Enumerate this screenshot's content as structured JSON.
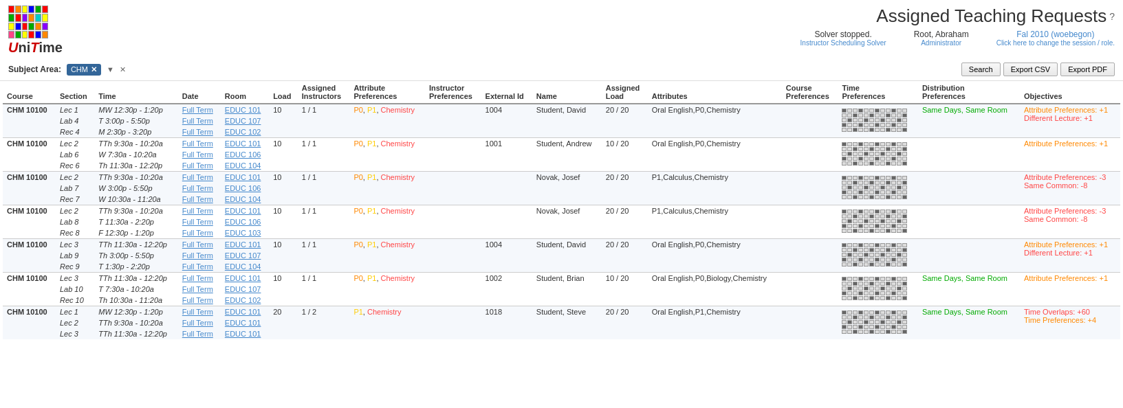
{
  "header": {
    "title": "Assigned Teaching Requests",
    "help_icon": "?",
    "solver_status": "Solver stopped.",
    "solver_label": "Instructor Scheduling Solver",
    "user_name": "Root, Abraham",
    "user_role": "Administrator",
    "session": "Fal 2010 (woebegon)",
    "session_sub": "Click here to change the session / role."
  },
  "toolbar": {
    "subject_area_label": "Subject Area:",
    "subject_tag": "CHM",
    "filter_down": "▼",
    "filter_clear": "✕",
    "search_label": "Search",
    "export_csv_label": "Export CSV",
    "export_pdf_label": "Export PDF"
  },
  "table": {
    "columns": [
      "Course",
      "Section",
      "Time",
      "Date",
      "Room",
      "Load",
      "Assigned Instructors",
      "Attribute Preferences",
      "Instructor Preferences",
      "External Id",
      "Name",
      "Assigned Load",
      "Attributes",
      "Course Preferences",
      "Time Preferences",
      "Distribution Preferences",
      "Objectives"
    ],
    "rows": [
      {
        "course": "CHM 10100",
        "section": "Lec 1",
        "time": "MW 12:30p - 1:20p",
        "date": "Full Term",
        "room": "EDUC 101",
        "load": "10",
        "assigned_load": "1 / 1",
        "attr_pref": "P0, P1, Chemistry",
        "instructor_pref": "",
        "external_id": "1004",
        "name": "Student, David",
        "assigned": "20 / 20",
        "attributes": "Oral English,P0,Chemistry",
        "course_pref": "",
        "dist_pref": "Same Days, Same Room",
        "objectives": "Attribute Preferences: +1\nDifferent Lecture: +1",
        "sub_rows": [
          {
            "section": "Lab 4",
            "time": "T 3:00p - 5:50p",
            "date": "Full Term",
            "room": "EDUC 107"
          },
          {
            "section": "Rec 4",
            "time": "M 2:30p - 3:20p",
            "date": "Full Term",
            "room": "EDUC 102"
          }
        ]
      },
      {
        "course": "CHM 10100",
        "section": "Lec 2",
        "time": "TTh 9:30a - 10:20a",
        "date": "Full Term",
        "room": "EDUC 101",
        "load": "10",
        "assigned_load": "1 / 1",
        "attr_pref": "P0, P1, Chemistry",
        "instructor_pref": "",
        "external_id": "1001",
        "name": "Student, Andrew",
        "assigned": "10 / 20",
        "attributes": "Oral English,P0,Chemistry",
        "course_pref": "",
        "dist_pref": "",
        "objectives": "Attribute Preferences: +1",
        "sub_rows": [
          {
            "section": "Lab 6",
            "time": "W 7:30a - 10:20a",
            "date": "Full Term",
            "room": "EDUC 106"
          },
          {
            "section": "Rec 6",
            "time": "Th 11:30a - 12:20p",
            "date": "Full Term",
            "room": "EDUC 104"
          }
        ]
      },
      {
        "course": "CHM 10100",
        "section": "Lec 2",
        "time": "TTh 9:30a - 10:20a",
        "date": "Full Term",
        "room": "EDUC 101",
        "load": "10",
        "assigned_load": "1 / 1",
        "attr_pref": "P0, P1, Chemistry",
        "instructor_pref": "",
        "external_id": "",
        "name": "Novak, Josef",
        "assigned": "20 / 20",
        "attributes": "P1,Calculus,Chemistry",
        "course_pref": "",
        "dist_pref": "",
        "objectives": "Attribute Preferences: -3\nSame Common: -8",
        "sub_rows": [
          {
            "section": "Lab 7",
            "time": "W 3:00p - 5:50p",
            "date": "Full Term",
            "room": "EDUC 106"
          },
          {
            "section": "Rec 7",
            "time": "W 10:30a - 11:20a",
            "date": "Full Term",
            "room": "EDUC 104"
          }
        ]
      },
      {
        "course": "CHM 10100",
        "section": "Lec 2",
        "time": "TTh 9:30a - 10:20a",
        "date": "Full Term",
        "room": "EDUC 101",
        "load": "10",
        "assigned_load": "1 / 1",
        "attr_pref": "P0, P1, Chemistry",
        "instructor_pref": "",
        "external_id": "",
        "name": "Novak, Josef",
        "assigned": "20 / 20",
        "attributes": "P1,Calculus,Chemistry",
        "course_pref": "",
        "dist_pref": "",
        "objectives": "Attribute Preferences: -3\nSame Common: -8",
        "sub_rows": [
          {
            "section": "Lab 8",
            "time": "T 11:30a - 2:20p",
            "date": "Full Term",
            "room": "EDUC 106"
          },
          {
            "section": "Rec 8",
            "time": "F 12:30p - 1:20p",
            "date": "Full Term",
            "room": "EDUC 103"
          }
        ]
      },
      {
        "course": "CHM 10100",
        "section": "Lec 3",
        "time": "TTh 11:30a - 12:20p",
        "date": "Full Term",
        "room": "EDUC 101",
        "load": "10",
        "assigned_load": "1 / 1",
        "attr_pref": "P0, P1, Chemistry",
        "instructor_pref": "",
        "external_id": "1004",
        "name": "Student, David",
        "assigned": "20 / 20",
        "attributes": "Oral English,P0,Chemistry",
        "course_pref": "",
        "dist_pref": "",
        "objectives": "Attribute Preferences: +1\nDifferent Lecture: +1",
        "sub_rows": [
          {
            "section": "Lab 9",
            "time": "Th 3:00p - 5:50p",
            "date": "Full Term",
            "room": "EDUC 107"
          },
          {
            "section": "Rec 9",
            "time": "T 1:30p - 2:20p",
            "date": "Full Term",
            "room": "EDUC 104"
          }
        ]
      },
      {
        "course": "CHM 10100",
        "section": "Lec 3",
        "time": "TTh 11:30a - 12:20p",
        "date": "Full Term",
        "room": "EDUC 101",
        "load": "10",
        "assigned_load": "1 / 1",
        "attr_pref": "P0, P1, Chemistry",
        "instructor_pref": "",
        "external_id": "1002",
        "name": "Student, Brian",
        "assigned": "10 / 20",
        "attributes": "Oral English,P0,Biology,Chemistry",
        "course_pref": "",
        "dist_pref": "Same Days, Same Room",
        "objectives": "Attribute Preferences: +1",
        "sub_rows": [
          {
            "section": "Lab 10",
            "time": "T 7:30a - 10:20a",
            "date": "Full Term",
            "room": "EDUC 107"
          },
          {
            "section": "Rec 10",
            "time": "Th 10:30a - 11:20a",
            "date": "Full Term",
            "room": "EDUC 102"
          }
        ]
      },
      {
        "course": "CHM 10100",
        "section": "Lec 1",
        "time": "MW 12:30p - 1:20p",
        "date": "Full Term",
        "room": "EDUC 101",
        "load": "20",
        "assigned_load": "1 / 2",
        "attr_pref": "P1, Chemistry",
        "instructor_pref": "",
        "external_id": "1018",
        "name": "Student, Steve",
        "assigned": "20 / 20",
        "attributes": "Oral English,P1,Chemistry",
        "course_pref": "",
        "dist_pref": "Same Days, Same Room",
        "objectives": "Time Overlaps: +60\nTime Preferences: +4",
        "sub_rows": [
          {
            "section": "Lec 2",
            "time": "TTh 9:30a - 10:20a",
            "date": "Full Term",
            "room": "EDUC 101"
          },
          {
            "section": "Lec 3",
            "time": "TTh 11:30a - 12:20p",
            "date": "Full Term",
            "room": "EDUC 101"
          }
        ]
      }
    ]
  },
  "logo": {
    "colors": [
      "#ff0000",
      "#ff8800",
      "#ffff00",
      "#00aa00",
      "#0000ff",
      "#8800ff",
      "#ffffff",
      "#cccccc",
      "#ff4488",
      "#00cccc",
      "#ff6600",
      "#44ff44"
    ]
  }
}
